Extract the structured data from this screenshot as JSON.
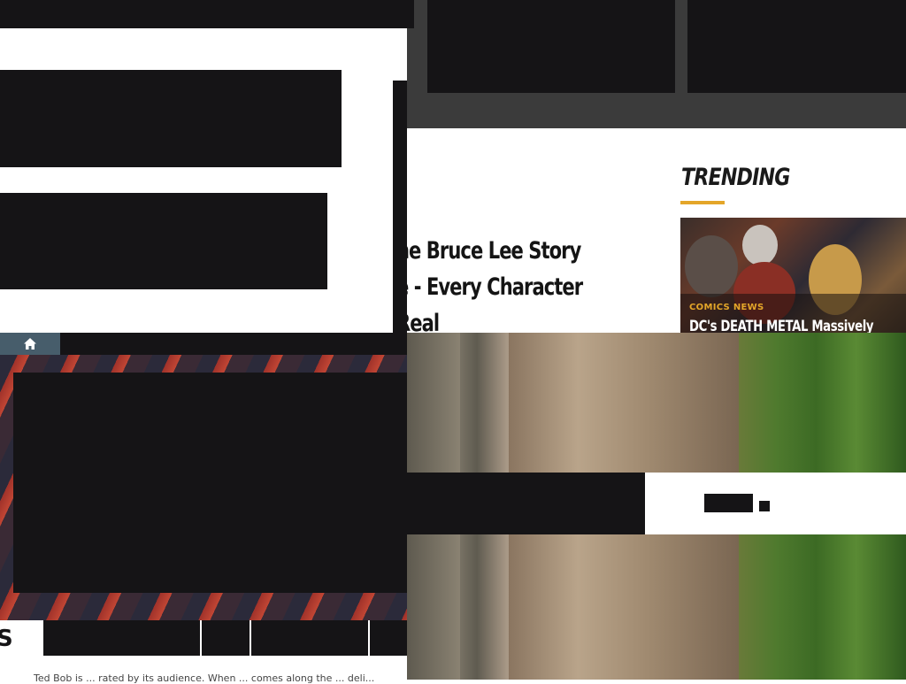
{
  "article": {
    "headline_lines": "he Bruce Lee Story\ne - Every Character\nReal"
  },
  "trending": {
    "title": "TRENDING",
    "accent_color": "#e4a629",
    "card": {
      "category": "COMICS NEWS",
      "headline": "DC's DEATH METAL Massively"
    }
  },
  "nav": {
    "home_icon": "home-icon",
    "home_color": "#475d6b"
  },
  "bottom": {
    "edge_text": "S",
    "blurb": "Ted Bob is ... rated by its audience. When ... comes along the ... deli..."
  }
}
